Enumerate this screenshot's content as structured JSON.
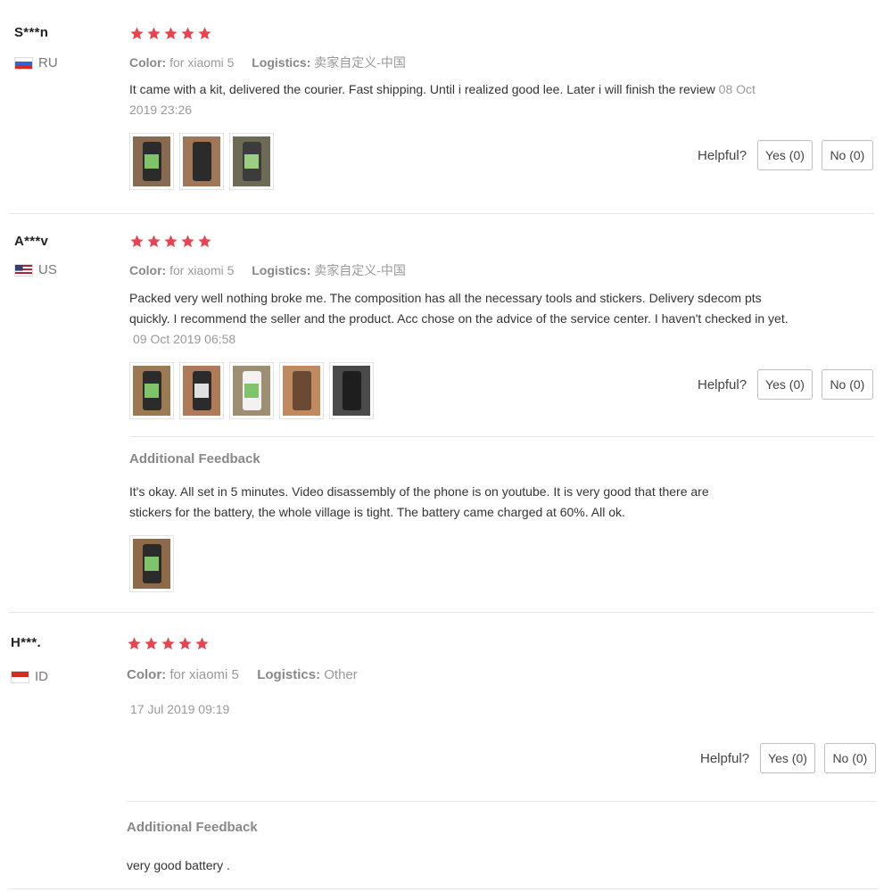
{
  "labels": {
    "color_key": "Color:",
    "logistics_key": "Logistics:",
    "helpful": "Helpful?",
    "additional_feedback": "Additional Feedback"
  },
  "colors": {
    "star": "#e8434f",
    "flag_ru": [
      "#ffffff",
      "#3366cc",
      "#d52b1e"
    ],
    "flag_id": [
      "#d52b1e",
      "#ffffff"
    ]
  },
  "reviews": [
    {
      "user": "S***n",
      "country_code": "RU",
      "rating": 5,
      "color_value": "for xiaomi 5",
      "logistics_value": "卖家自定义-中国",
      "text": "It came with a kit, delivered the courier. Fast shipping. Until i realized good lee. Later i will finish the review",
      "date": "08 Oct 2019 23:26",
      "photo_count": 3,
      "yes_label": "Yes (0)",
      "no_label": "No (0)"
    },
    {
      "user": "A***v",
      "country_code": "US",
      "rating": 5,
      "color_value": "for xiaomi 5",
      "logistics_value": "卖家自定义-中国",
      "text_line1": "Packed very well nothing broke me. The composition has all the necessary tools and stickers. Delivery sdecom pts",
      "text_line2": "quickly. I recommend the seller and the product. Acc chose on the advice of the service center. I haven't checked in yet.",
      "date": "09 Oct 2019 06:58",
      "photo_count": 5,
      "yes_label": "Yes (0)",
      "no_label": "No (0)",
      "additional": {
        "text_line1": "It's okay. All set in 5 minutes. Video disassembly of the phone is on youtube. It is very good that there are",
        "text_line2": "stickers for the battery, the whole village is tight. The battery came charged at 60%. All ok.",
        "photo_count": 1
      }
    },
    {
      "user": "H***.",
      "country_code": "ID",
      "rating": 5,
      "color_value": "for xiaomi 5",
      "logistics_value": "Other",
      "date": "17 Jul 2019 09:19",
      "yes_label": "Yes (0)",
      "no_label": "No (0)",
      "additional": {
        "text": "very good battery ."
      }
    }
  ]
}
